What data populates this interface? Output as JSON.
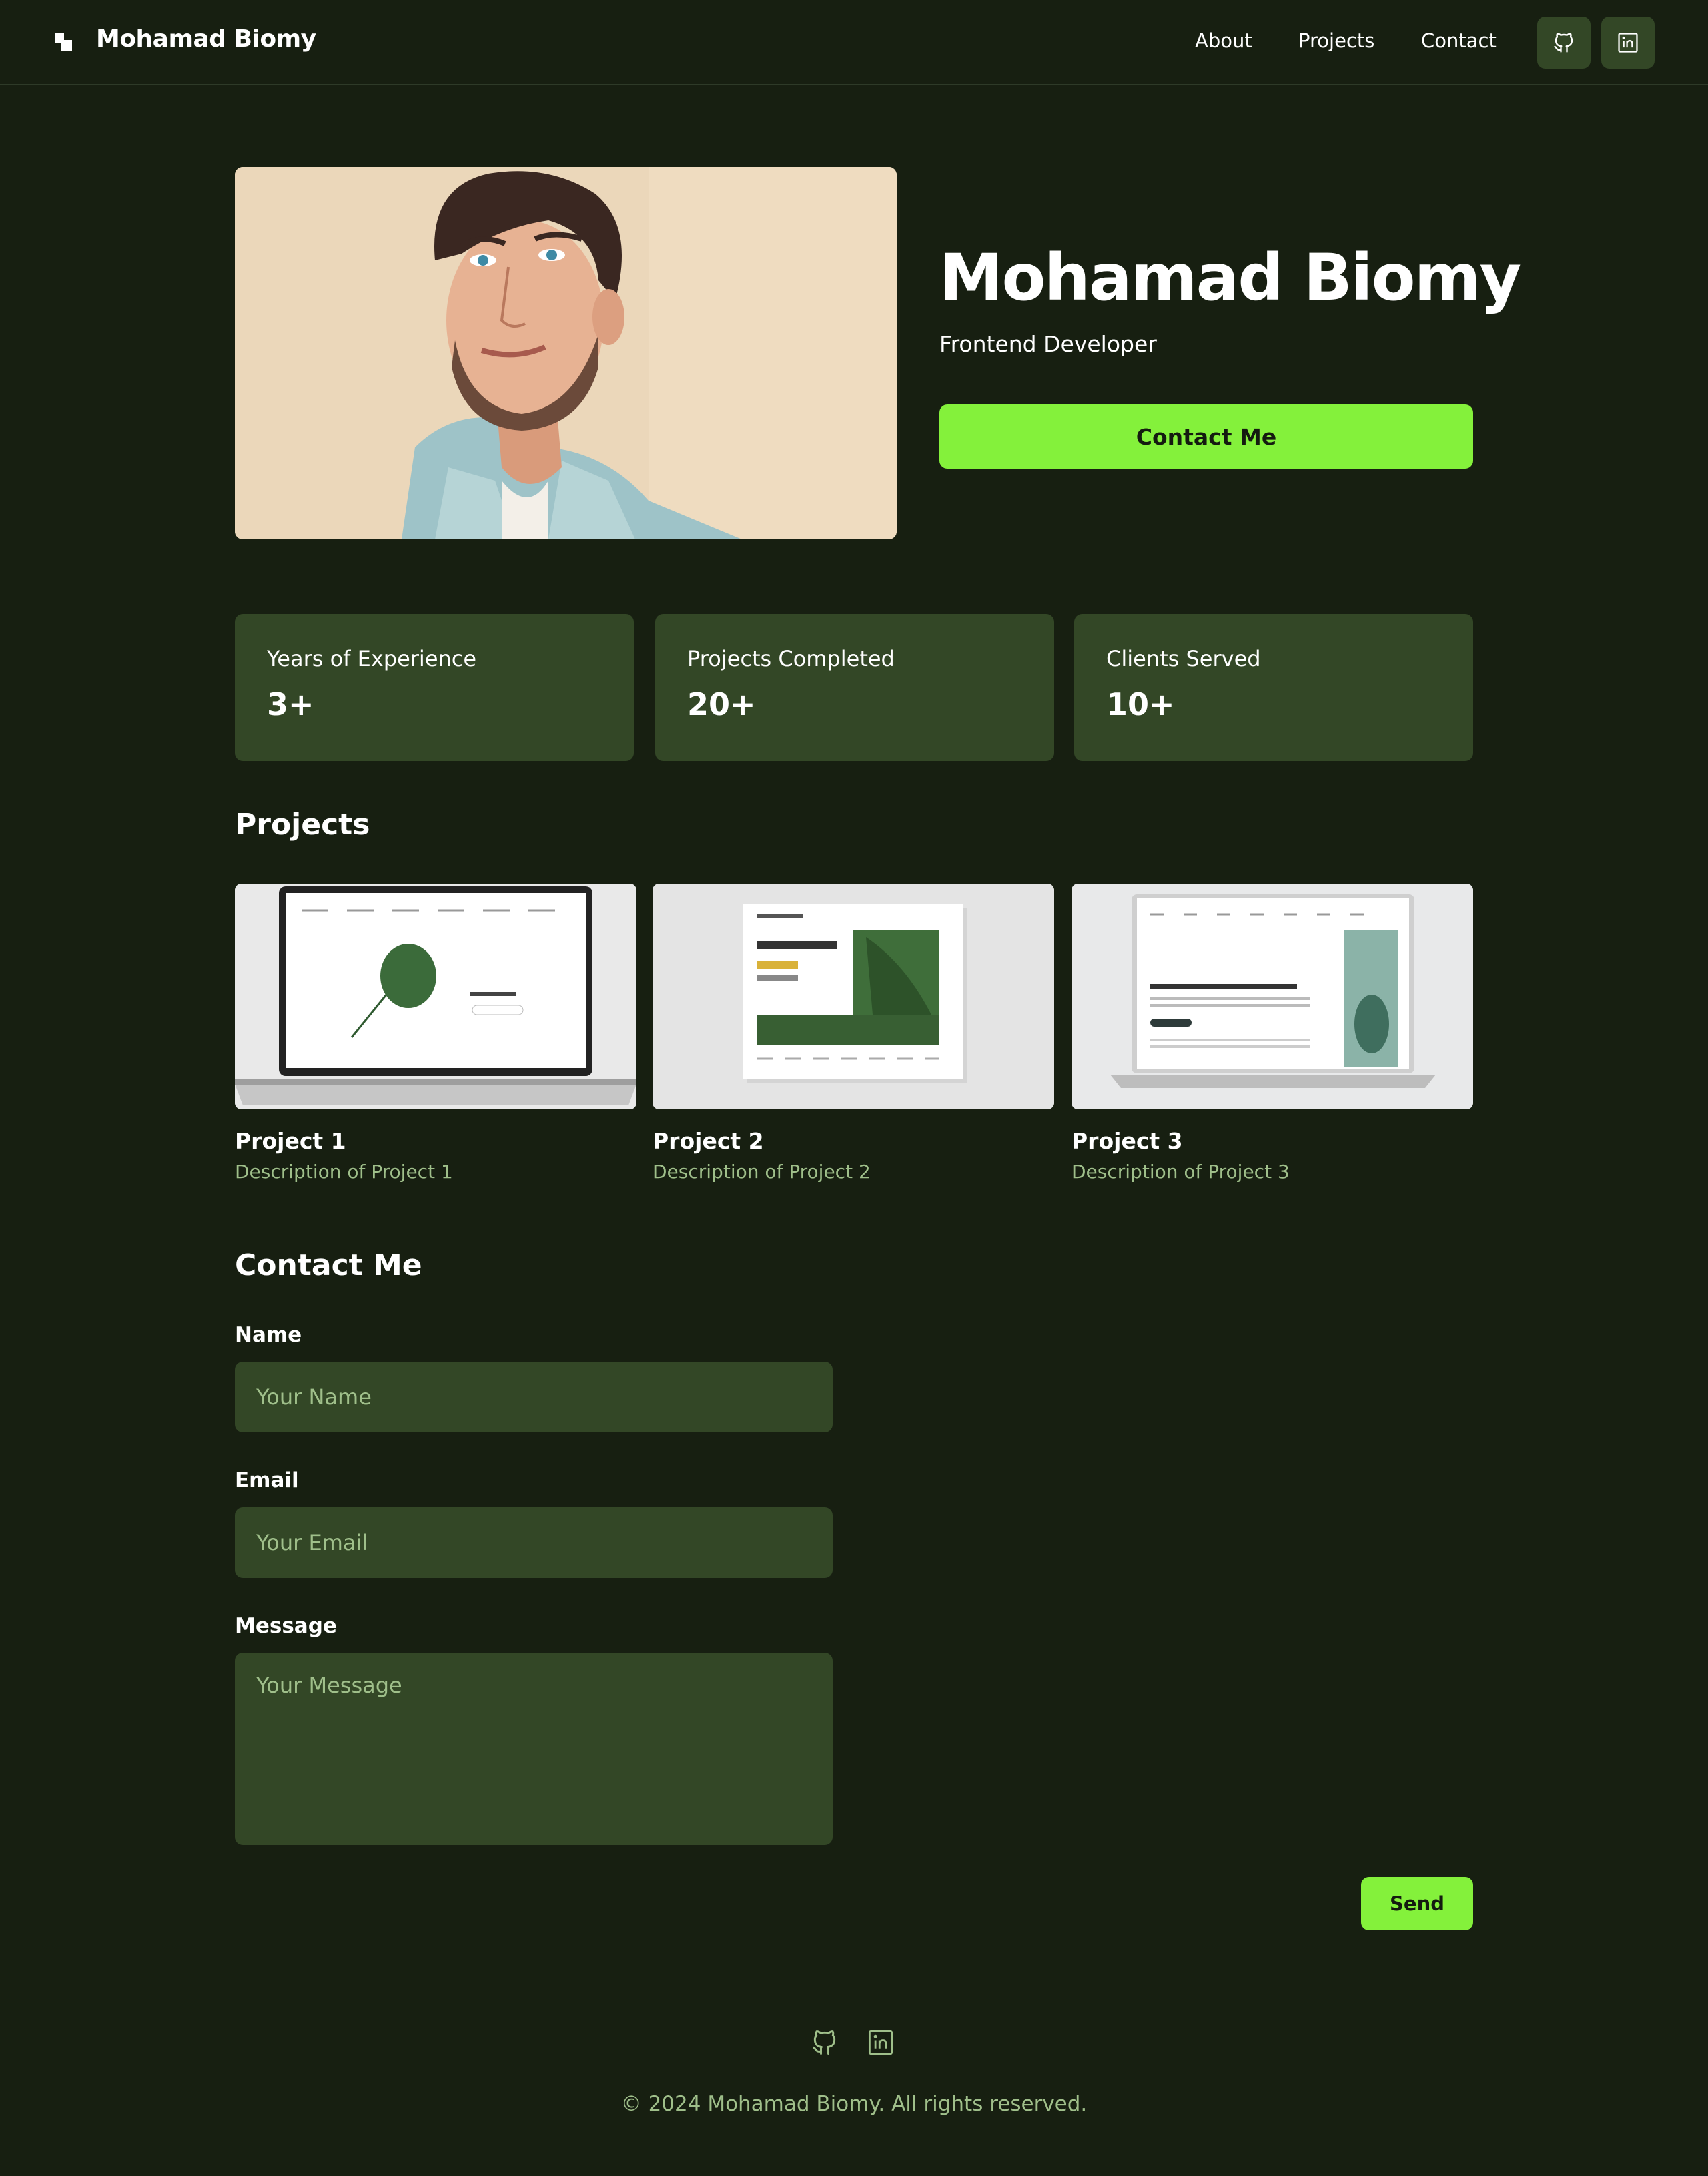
{
  "header": {
    "brand": "Mohamad Biomy",
    "nav": [
      "About",
      "Projects",
      "Contact"
    ],
    "social_icons": [
      "github-icon",
      "linkedin-icon"
    ]
  },
  "hero": {
    "name": "Mohamad Biomy",
    "role": "Frontend Developer",
    "cta_label": "Contact Me"
  },
  "stats": [
    {
      "label": "Years of Experience",
      "value": "3+"
    },
    {
      "label": "Projects Completed",
      "value": "20+"
    },
    {
      "label": "Clients Served",
      "value": "10+"
    }
  ],
  "projects": {
    "title": "Projects",
    "items": [
      {
        "title": "Project 1",
        "description": "Description of Project 1"
      },
      {
        "title": "Project 2",
        "description": "Description of Project 2"
      },
      {
        "title": "Project 3",
        "description": "Description of Project 3"
      }
    ]
  },
  "contact": {
    "title": "Contact Me",
    "name_label": "Name",
    "name_placeholder": "Your Name",
    "email_label": "Email",
    "email_placeholder": "Your Email",
    "message_label": "Message",
    "message_placeholder": "Your Message",
    "send_label": "Send"
  },
  "footer": {
    "copyright": "© 2024 Mohamad Biomy. All rights reserved."
  },
  "colors": {
    "background": "#171f11",
    "card": "#334726",
    "accent": "#84f13b",
    "muted_text": "#9fbf8a"
  }
}
